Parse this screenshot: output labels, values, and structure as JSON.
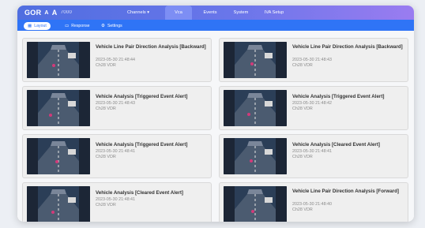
{
  "app": {
    "logo_text": "GOR",
    "logo_mark": "A",
    "logo_suffix": "A",
    "logo_sub": "7000"
  },
  "topnav": {
    "items": [
      {
        "label": "Channels ▾",
        "active": false
      },
      {
        "label": "Vca",
        "active": true
      },
      {
        "label": "Events",
        "active": false
      },
      {
        "label": "System",
        "active": false
      },
      {
        "label": "IVA Setup",
        "active": false
      }
    ]
  },
  "subnav": {
    "items": [
      {
        "label": "Layout",
        "icon": "layout-icon",
        "active": true
      },
      {
        "label": "Response",
        "icon": "response-icon",
        "active": false
      },
      {
        "label": "Settings",
        "icon": "gear-icon",
        "active": false
      }
    ]
  },
  "events": [
    {
      "title": "Vehicle Line Pair Direction Analysis [Backward]",
      "time": "2023-05-30 21:48:44",
      "source": "Ch28 VDR"
    },
    {
      "title": "Vehicle Line Pair Direction Analysis [Backward]",
      "time": "2023-05-30 21:48:43",
      "source": "Ch28 VDR"
    },
    {
      "title": "Vehicle Analysis [Triggered Event Alert]",
      "time": "2023-05-30 21:48:43",
      "source": "Ch28 VDR"
    },
    {
      "title": "Vehicle Analysis [Triggered Event Alert]",
      "time": "2023-05-30 21:48:42",
      "source": "Ch28 VDR"
    },
    {
      "title": "Vehicle Analysis [Triggered Event Alert]",
      "time": "2023-05-30 21:48:41",
      "source": "Ch28 VDR"
    },
    {
      "title": "Vehicle Analysis [Cleared Event Alert]",
      "time": "2023-05-30 21:48:41",
      "source": "Ch28 VDR"
    },
    {
      "title": "Vehicle Analysis [Cleared Event Alert]",
      "time": "2023-05-30 21:48:41",
      "source": "Ch28 VDR"
    },
    {
      "title": "Vehicle Line Pair Direction Analysis [Forward]",
      "time": "2023-05-30 21:48:40",
      "source": "Ch28 VDR"
    }
  ],
  "colors": {
    "topbar_start": "#4f6ee0",
    "topbar_end": "#9a7cf0",
    "subbar": "#2f74f6",
    "card_bg": "#efefef"
  }
}
